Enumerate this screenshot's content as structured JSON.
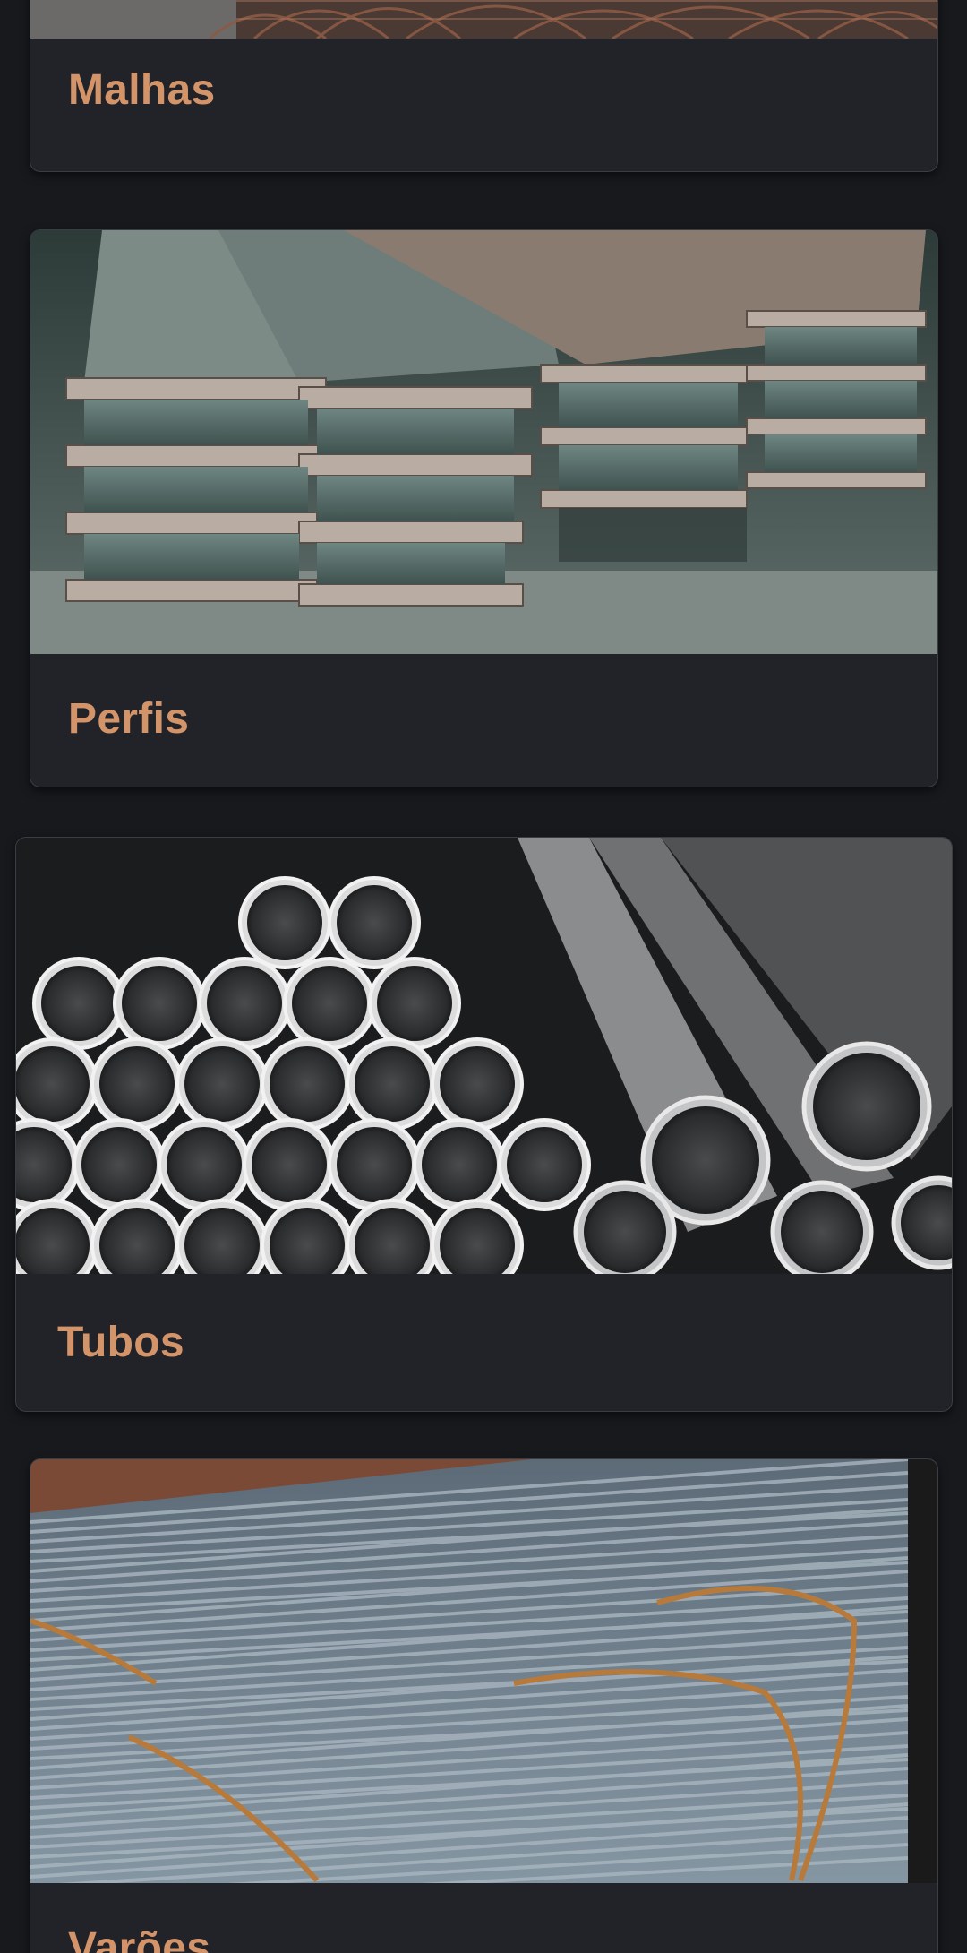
{
  "categories": [
    {
      "title": "Malhas",
      "image": "wire-mesh-photo"
    },
    {
      "title": "Perfis",
      "image": "steel-beams-photo"
    },
    {
      "title": "Tubos",
      "image": "steel-tubes-photo"
    },
    {
      "title": "Varões",
      "image": "rebar-bundle-photo"
    }
  ],
  "colors": {
    "background": "#17191d",
    "card": "#212328",
    "title": "#d4946a"
  }
}
